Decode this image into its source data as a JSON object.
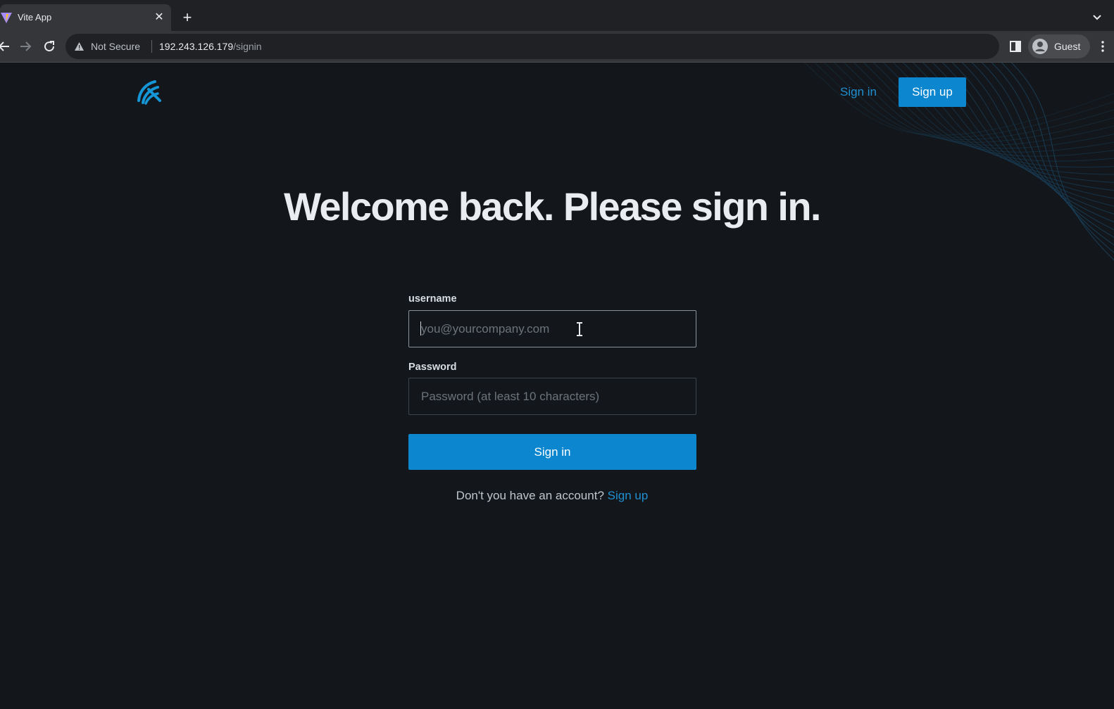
{
  "browser": {
    "tab_title": "Vite App",
    "security_label": "Not Secure",
    "url_host": "192.243.126.179",
    "url_path": "/signin",
    "profile_name": "Guest"
  },
  "header": {
    "signin_label": "Sign in",
    "signup_label": "Sign up"
  },
  "main": {
    "headline": "Welcome back. Please sign in.",
    "username_label": "username",
    "username_placeholder": "you@yourcompany.com",
    "password_label": "Password",
    "password_placeholder": "Password (at least 10 characters)",
    "submit_label": "Sign in",
    "footer_text": "Don't you have an account?",
    "footer_link": "Sign up"
  },
  "colors": {
    "accent": "#0b86cf",
    "link": "#1f8fd1",
    "background": "#13171b"
  }
}
